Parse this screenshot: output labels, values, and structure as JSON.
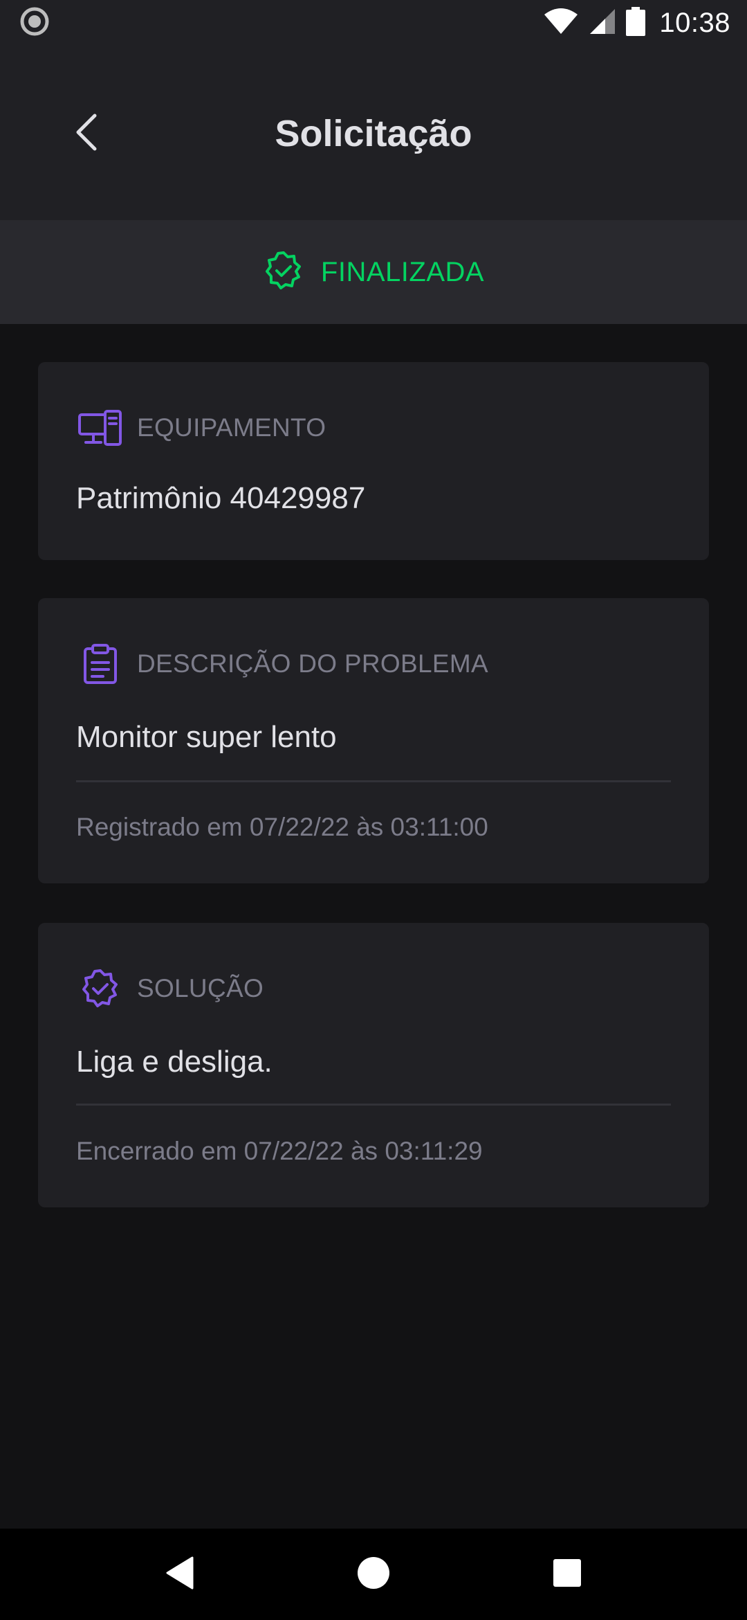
{
  "status_bar": {
    "time": "10:38",
    "icons": [
      "notification-dot-icon",
      "wifi-icon",
      "cell-signal-icon",
      "battery-icon"
    ]
  },
  "header": {
    "title": "Solicitação",
    "back_icon": "chevron-left-icon"
  },
  "status_banner": {
    "label": "FINALIZADA",
    "icon": "badge-check-icon",
    "color": "#04D361"
  },
  "cards": {
    "equipment": {
      "title": "EQUIPAMENTO",
      "icon": "desktop-devices-icon",
      "value": "Patrimônio 40429987"
    },
    "problem": {
      "title": "DESCRIÇÃO DO PROBLEMA",
      "icon": "clipboard-icon",
      "value": "Monitor super lento",
      "meta": "Registrado em 07/22/22 às 03:11:00"
    },
    "solution": {
      "title": "SOLUÇÃO",
      "icon": "badge-check-icon",
      "value": "Liga e desliga.",
      "meta": "Encerrado em 07/22/22 às 03:11:29"
    }
  },
  "colors": {
    "accent": "#8257E5",
    "success": "#04D361",
    "background": "#121214",
    "surface": "#202024"
  },
  "nav_bar": {
    "icons": [
      "back-triangle-icon",
      "home-circle-icon",
      "recents-square-icon"
    ]
  }
}
